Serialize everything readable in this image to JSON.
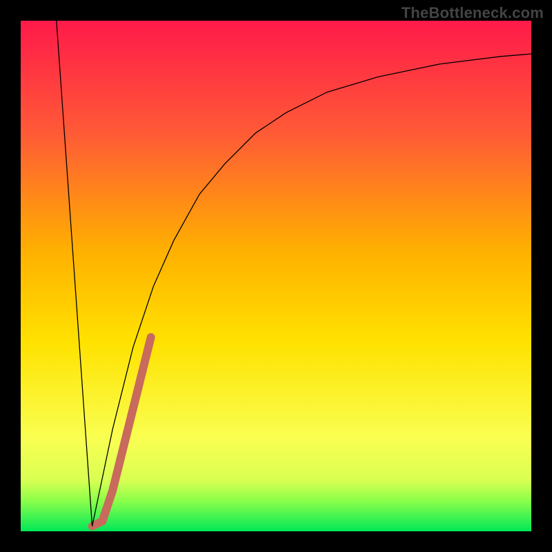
{
  "watermark": "TheBottleneck.com",
  "chart_data": {
    "type": "line",
    "title": "",
    "xlabel": "",
    "ylabel": "",
    "xlim": [
      0,
      100
    ],
    "ylim": [
      0,
      100
    ],
    "grid": false,
    "legend": false,
    "background_gradient": {
      "top": "#ff1a4a",
      "mid_upper": "#ff7a2a",
      "mid": "#ffd400",
      "mid_lower": "#f6ff4a",
      "green_band": "#8cff4a",
      "bottom": "#00e858"
    },
    "series": [
      {
        "name": "left-descent",
        "stroke": "#000000",
        "stroke_width": 1.3,
        "x": [
          7,
          14
        ],
        "y": [
          100,
          1
        ]
      },
      {
        "name": "rising-curve",
        "stroke": "#000000",
        "stroke_width": 1.3,
        "x": [
          14,
          18,
          22,
          26,
          30,
          35,
          40,
          46,
          52,
          60,
          70,
          82,
          94,
          100
        ],
        "y": [
          1,
          20,
          36,
          48,
          57,
          66,
          72,
          78,
          82,
          86,
          89,
          91.5,
          93,
          93.5
        ]
      },
      {
        "name": "highlight-segment",
        "stroke": "#c86a5c",
        "stroke_width": 12,
        "linecap": "round",
        "x": [
          14,
          16,
          18,
          20,
          22,
          24,
          25.5
        ],
        "y": [
          1,
          2,
          8,
          16,
          24,
          32,
          38
        ]
      }
    ]
  }
}
